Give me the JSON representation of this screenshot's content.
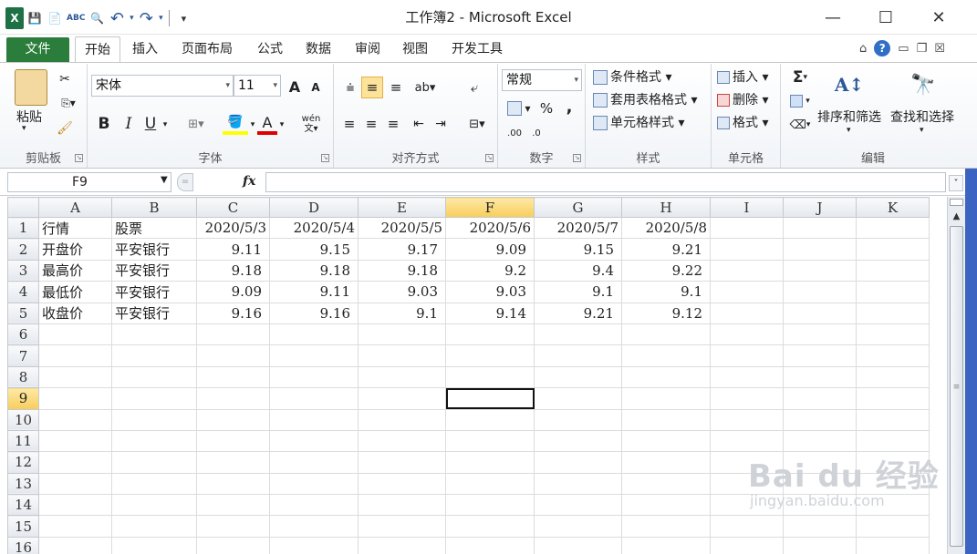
{
  "window": {
    "title": "工作簿2 - Microsoft Excel",
    "minimize": "—",
    "maximize": "☐",
    "close": "✕"
  },
  "qat": {
    "save": "💾",
    "new": "📄",
    "spell": "ABC",
    "preview": "🔍",
    "undo": "↶",
    "redo": "↷",
    "customize": "▾"
  },
  "tabs": [
    {
      "label": "文件"
    },
    {
      "label": "开始"
    },
    {
      "label": "插入"
    },
    {
      "label": "页面布局"
    },
    {
      "label": "公式"
    },
    {
      "label": "数据"
    },
    {
      "label": "审阅"
    },
    {
      "label": "视图"
    },
    {
      "label": "开发工具"
    }
  ],
  "ribbon": {
    "clipboard": {
      "paste": "粘贴",
      "label": "剪贴板"
    },
    "font": {
      "name": "宋体",
      "size": "11",
      "bold": "B",
      "italic": "I",
      "underline": "U",
      "label": "字体",
      "grow": "A",
      "shrink": "A",
      "phonetic": "wén"
    },
    "alignment": {
      "label": "对齐方式"
    },
    "number": {
      "format": "常规",
      "percent": "%",
      "comma": ",",
      "inc": ".00",
      "dec": ".0",
      "label": "数字"
    },
    "styles": {
      "conditional": "条件格式",
      "table": "套用表格格式",
      "cell": "单元格样式",
      "label": "样式"
    },
    "cells": {
      "insert": "插入",
      "delete": "删除",
      "format": "格式",
      "label": "单元格"
    },
    "editing": {
      "sigma": "Σ",
      "sort": "排序和筛选",
      "find": "查找和选择",
      "label": "编辑"
    }
  },
  "formula": {
    "name_box": "F9",
    "fx": "fx",
    "value": ""
  },
  "columns": [
    "A",
    "B",
    "C",
    "D",
    "E",
    "F",
    "G",
    "H",
    "I",
    "J",
    "K"
  ],
  "rows": [
    [
      "行情",
      "股票",
      "2020/5/3",
      "2020/5/4",
      "2020/5/5",
      "2020/5/6",
      "2020/5/7",
      "2020/5/8",
      "",
      "",
      ""
    ],
    [
      "开盘价",
      "平安银行",
      "9.11",
      "9.15",
      "9.17",
      "9.09",
      "9.15",
      "9.21",
      "",
      "",
      ""
    ],
    [
      "最高价",
      "平安银行",
      "9.18",
      "9.18",
      "9.18",
      "9.2",
      "9.4",
      "9.22",
      "",
      "",
      ""
    ],
    [
      "最低价",
      "平安银行",
      "9.09",
      "9.11",
      "9.03",
      "9.03",
      "9.1",
      "9.1",
      "",
      "",
      ""
    ],
    [
      "收盘价",
      "平安银行",
      "9.16",
      "9.16",
      "9.1",
      "9.14",
      "9.21",
      "9.12",
      "",
      "",
      ""
    ],
    [
      "",
      "",
      "",
      "",
      "",
      "",
      "",
      "",
      "",
      "",
      ""
    ],
    [
      "",
      "",
      "",
      "",
      "",
      "",
      "",
      "",
      "",
      "",
      ""
    ],
    [
      "",
      "",
      "",
      "",
      "",
      "",
      "",
      "",
      "",
      "",
      ""
    ],
    [
      "",
      "",
      "",
      "",
      "",
      "",
      "",
      "",
      "",
      "",
      ""
    ],
    [
      "",
      "",
      "",
      "",
      "",
      "",
      "",
      "",
      "",
      "",
      ""
    ],
    [
      "",
      "",
      "",
      "",
      "",
      "",
      "",
      "",
      "",
      "",
      ""
    ],
    [
      "",
      "",
      "",
      "",
      "",
      "",
      "",
      "",
      "",
      "",
      ""
    ],
    [
      "",
      "",
      "",
      "",
      "",
      "",
      "",
      "",
      "",
      "",
      ""
    ],
    [
      "",
      "",
      "",
      "",
      "",
      "",
      "",
      "",
      "",
      "",
      ""
    ],
    [
      "",
      "",
      "",
      "",
      "",
      "",
      "",
      "",
      "",
      "",
      ""
    ],
    [
      "",
      "",
      "",
      "",
      "",
      "",
      "",
      "",
      "",
      "",
      ""
    ]
  ],
  "row_numbers": [
    "1",
    "2",
    "3",
    "4",
    "5",
    "6",
    "7",
    "8",
    "9",
    "10",
    "11",
    "12",
    "13",
    "14",
    "15",
    "16"
  ],
  "active_cell": {
    "col": "F",
    "row": "9"
  },
  "watermark": {
    "brand": "Bai du 经验",
    "url": "jingyan.baidu.com"
  }
}
